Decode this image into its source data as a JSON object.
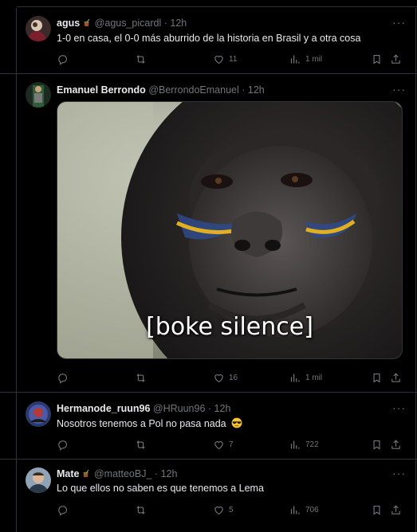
{
  "tweets": [
    {
      "name": "agus",
      "handle": "@agus_picardl",
      "dot": "·",
      "time": "12h",
      "text": "1-0 en casa, el 0-0 más aburrido de la historia en Brasil y a otra cosa",
      "likes": "11",
      "views": "1 mil",
      "name_emoji": "mate-icon"
    },
    {
      "name": "Emanuel Berrondo",
      "handle": "@BerrondoEmanuel",
      "dot": "·",
      "time": "12h",
      "media_caption": "[boke silence]",
      "likes": "16",
      "views": "1 mil"
    },
    {
      "name": "Hermanode_ruun96",
      "handle": "@HRuun96",
      "dot": "·",
      "time": "12h",
      "text": "Nosotros tenemos a Pol no pasa nada",
      "text_emoji": "sunglasses-emoji",
      "likes": "7",
      "views": "722"
    },
    {
      "name": "Mate",
      "handle": "@matteoBJ_",
      "dot": "·",
      "time": "12h",
      "text": "Lo que ellos no saben es que tenemos a Lema",
      "likes": "5",
      "views": "706",
      "name_emoji": "mate-icon"
    }
  ],
  "more_label": "···",
  "colors": {
    "background": "#000000",
    "text": "#e7e9ea",
    "muted": "#71767b",
    "border": "#2f3336"
  }
}
